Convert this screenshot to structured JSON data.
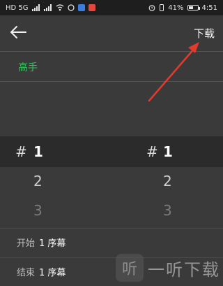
{
  "status_bar": {
    "left_text": "HD 5G",
    "battery_percent": "41%",
    "time": "4:51"
  },
  "toolbar": {
    "back_icon": "arrow-left-icon",
    "download_label": "下载"
  },
  "level": {
    "label": "高手"
  },
  "picker": {
    "left": {
      "hash": "#",
      "selected": "1",
      "second": "2",
      "third": "3"
    },
    "right": {
      "hash": "#",
      "selected": "1",
      "second": "2",
      "third": "3"
    }
  },
  "range": {
    "start_label": "开始",
    "start_value": "1 序幕",
    "end_label": "结束",
    "end_value": "1 序幕"
  },
  "watermark": {
    "logo_char": "听",
    "text": "一听下载"
  },
  "colors": {
    "background": "#3a3a3a",
    "accent_green": "#33c65f",
    "annotation_red": "#e23b2e"
  }
}
